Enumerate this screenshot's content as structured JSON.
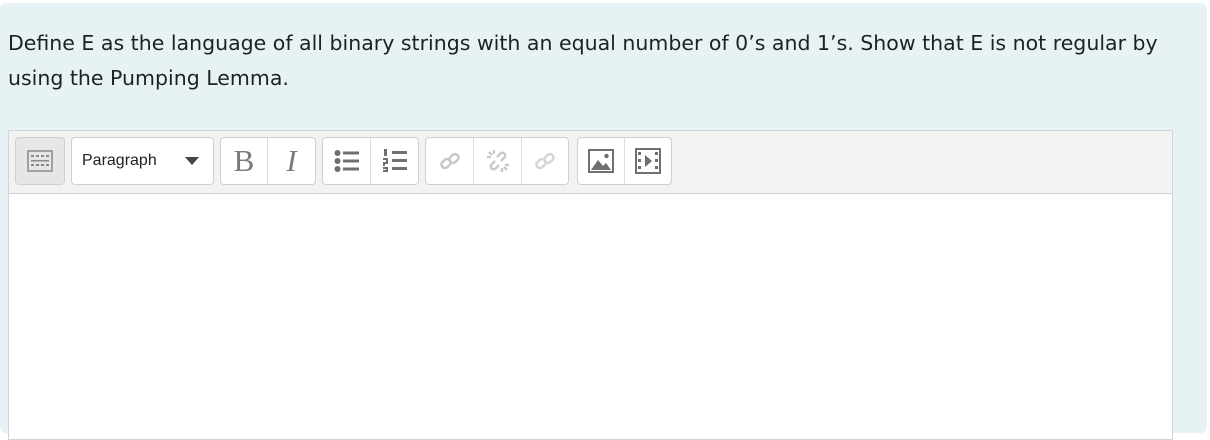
{
  "question": {
    "text": "Define E as the language of all binary strings with an equal number of 0’s and 1’s. Show that E is not regular by using the Pumping Lemma."
  },
  "editor": {
    "toolbar": {
      "collapse_icon": "keyboard-icon",
      "format_select_value": "Paragraph",
      "bold_label": "B",
      "italic_label": "I",
      "unordered_list_icon": "bullet-list-icon",
      "ordered_list_icon": "numbered-list-icon",
      "link_icon": "link-icon",
      "unlink_icon": "unlink-icon",
      "anchor_icon": "anchor-link-icon",
      "image_icon": "image-icon",
      "media_icon": "media-icon"
    },
    "content": ""
  }
}
